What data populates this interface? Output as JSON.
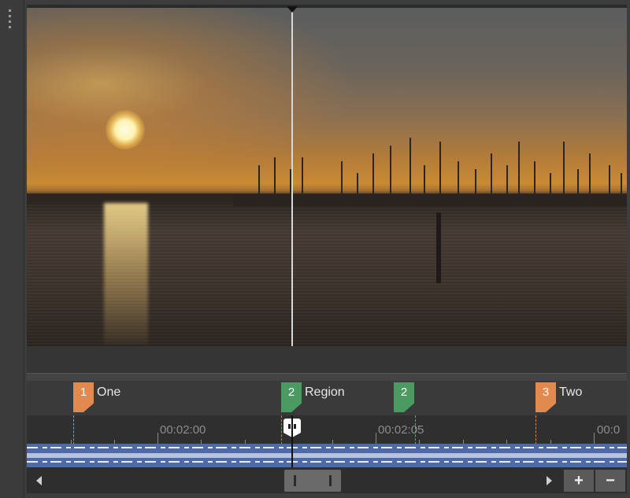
{
  "markers": [
    {
      "number": "1",
      "label": "One",
      "color": "#e08a50",
      "kind": "marker"
    },
    {
      "number": "2",
      "label": "Region",
      "color": "#4a9a62",
      "kind": "region-start"
    },
    {
      "number": "2",
      "label": "",
      "color": "#4a9a62",
      "kind": "region-end"
    },
    {
      "number": "3",
      "label": "Two",
      "color": "#e08a50",
      "kind": "marker"
    }
  ],
  "ruler": {
    "labels": [
      "00:02:00",
      "00:02:05",
      "00:0"
    ]
  },
  "zoom": {
    "in_icon": "+",
    "out_icon": "−"
  },
  "icons": {
    "grip": "drag-grip-icon",
    "scroll_left": "arrow-left-icon",
    "scroll_right": "arrow-right-icon"
  }
}
